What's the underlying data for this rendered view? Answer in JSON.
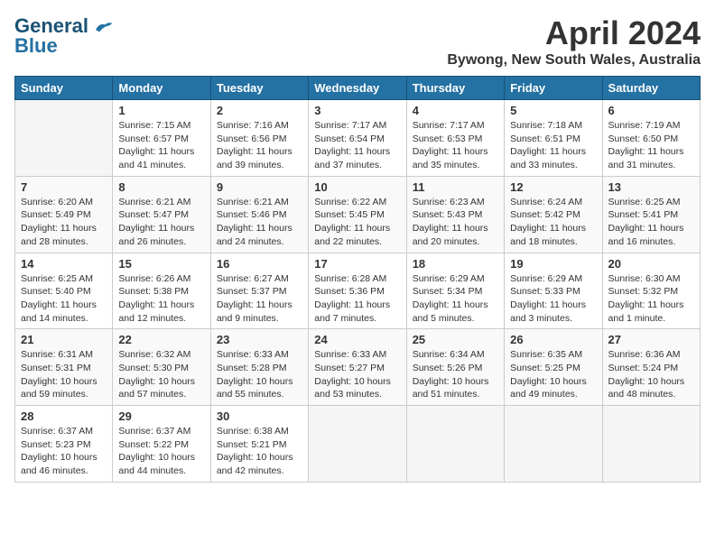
{
  "header": {
    "logo_line1": "General",
    "logo_line2": "Blue",
    "title": "April 2024",
    "subtitle": "Bywong, New South Wales, Australia"
  },
  "calendar": {
    "days_of_week": [
      "Sunday",
      "Monday",
      "Tuesday",
      "Wednesday",
      "Thursday",
      "Friday",
      "Saturday"
    ],
    "weeks": [
      [
        {
          "day": "",
          "info": ""
        },
        {
          "day": "1",
          "info": "Sunrise: 7:15 AM\nSunset: 6:57 PM\nDaylight: 11 hours\nand 41 minutes."
        },
        {
          "day": "2",
          "info": "Sunrise: 7:16 AM\nSunset: 6:56 PM\nDaylight: 11 hours\nand 39 minutes."
        },
        {
          "day": "3",
          "info": "Sunrise: 7:17 AM\nSunset: 6:54 PM\nDaylight: 11 hours\nand 37 minutes."
        },
        {
          "day": "4",
          "info": "Sunrise: 7:17 AM\nSunset: 6:53 PM\nDaylight: 11 hours\nand 35 minutes."
        },
        {
          "day": "5",
          "info": "Sunrise: 7:18 AM\nSunset: 6:51 PM\nDaylight: 11 hours\nand 33 minutes."
        },
        {
          "day": "6",
          "info": "Sunrise: 7:19 AM\nSunset: 6:50 PM\nDaylight: 11 hours\nand 31 minutes."
        }
      ],
      [
        {
          "day": "7",
          "info": "Sunrise: 6:20 AM\nSunset: 5:49 PM\nDaylight: 11 hours\nand 28 minutes."
        },
        {
          "day": "8",
          "info": "Sunrise: 6:21 AM\nSunset: 5:47 PM\nDaylight: 11 hours\nand 26 minutes."
        },
        {
          "day": "9",
          "info": "Sunrise: 6:21 AM\nSunset: 5:46 PM\nDaylight: 11 hours\nand 24 minutes."
        },
        {
          "day": "10",
          "info": "Sunrise: 6:22 AM\nSunset: 5:45 PM\nDaylight: 11 hours\nand 22 minutes."
        },
        {
          "day": "11",
          "info": "Sunrise: 6:23 AM\nSunset: 5:43 PM\nDaylight: 11 hours\nand 20 minutes."
        },
        {
          "day": "12",
          "info": "Sunrise: 6:24 AM\nSunset: 5:42 PM\nDaylight: 11 hours\nand 18 minutes."
        },
        {
          "day": "13",
          "info": "Sunrise: 6:25 AM\nSunset: 5:41 PM\nDaylight: 11 hours\nand 16 minutes."
        }
      ],
      [
        {
          "day": "14",
          "info": "Sunrise: 6:25 AM\nSunset: 5:40 PM\nDaylight: 11 hours\nand 14 minutes."
        },
        {
          "day": "15",
          "info": "Sunrise: 6:26 AM\nSunset: 5:38 PM\nDaylight: 11 hours\nand 12 minutes."
        },
        {
          "day": "16",
          "info": "Sunrise: 6:27 AM\nSunset: 5:37 PM\nDaylight: 11 hours\nand 9 minutes."
        },
        {
          "day": "17",
          "info": "Sunrise: 6:28 AM\nSunset: 5:36 PM\nDaylight: 11 hours\nand 7 minutes."
        },
        {
          "day": "18",
          "info": "Sunrise: 6:29 AM\nSunset: 5:34 PM\nDaylight: 11 hours\nand 5 minutes."
        },
        {
          "day": "19",
          "info": "Sunrise: 6:29 AM\nSunset: 5:33 PM\nDaylight: 11 hours\nand 3 minutes."
        },
        {
          "day": "20",
          "info": "Sunrise: 6:30 AM\nSunset: 5:32 PM\nDaylight: 11 hours\nand 1 minute."
        }
      ],
      [
        {
          "day": "21",
          "info": "Sunrise: 6:31 AM\nSunset: 5:31 PM\nDaylight: 10 hours\nand 59 minutes."
        },
        {
          "day": "22",
          "info": "Sunrise: 6:32 AM\nSunset: 5:30 PM\nDaylight: 10 hours\nand 57 minutes."
        },
        {
          "day": "23",
          "info": "Sunrise: 6:33 AM\nSunset: 5:28 PM\nDaylight: 10 hours\nand 55 minutes."
        },
        {
          "day": "24",
          "info": "Sunrise: 6:33 AM\nSunset: 5:27 PM\nDaylight: 10 hours\nand 53 minutes."
        },
        {
          "day": "25",
          "info": "Sunrise: 6:34 AM\nSunset: 5:26 PM\nDaylight: 10 hours\nand 51 minutes."
        },
        {
          "day": "26",
          "info": "Sunrise: 6:35 AM\nSunset: 5:25 PM\nDaylight: 10 hours\nand 49 minutes."
        },
        {
          "day": "27",
          "info": "Sunrise: 6:36 AM\nSunset: 5:24 PM\nDaylight: 10 hours\nand 48 minutes."
        }
      ],
      [
        {
          "day": "28",
          "info": "Sunrise: 6:37 AM\nSunset: 5:23 PM\nDaylight: 10 hours\nand 46 minutes."
        },
        {
          "day": "29",
          "info": "Sunrise: 6:37 AM\nSunset: 5:22 PM\nDaylight: 10 hours\nand 44 minutes."
        },
        {
          "day": "30",
          "info": "Sunrise: 6:38 AM\nSunset: 5:21 PM\nDaylight: 10 hours\nand 42 minutes."
        },
        {
          "day": "",
          "info": ""
        },
        {
          "day": "",
          "info": ""
        },
        {
          "day": "",
          "info": ""
        },
        {
          "day": "",
          "info": ""
        }
      ]
    ]
  }
}
